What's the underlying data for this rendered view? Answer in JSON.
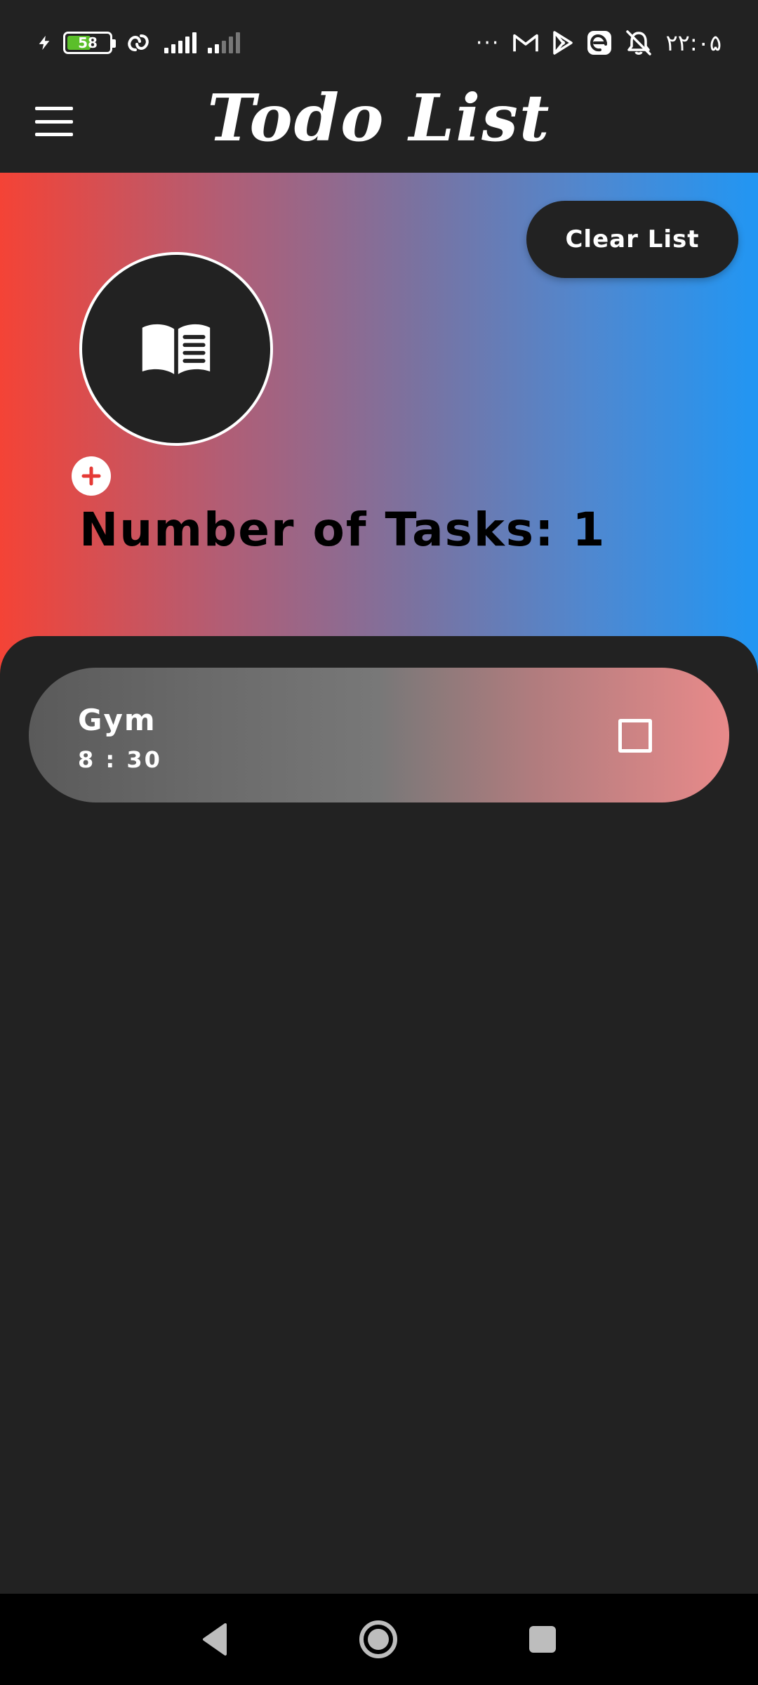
{
  "status_bar": {
    "battery": "58",
    "battery_level": 0.58,
    "time": "۲۲:۰۵",
    "more": "···",
    "icons": [
      "charging-icon",
      "battery-icon",
      "link-icon",
      "signal-icon",
      "signal-icon",
      "gmail-icon",
      "play-store-icon",
      "edge-icon",
      "alarm-off-icon"
    ]
  },
  "app_bar": {
    "title": "Todo List"
  },
  "hero": {
    "clear_label": "Clear List",
    "task_count_label": "Number of Tasks: 1"
  },
  "tasks": [
    {
      "title": "Gym",
      "time": "8 : 30",
      "done": false
    }
  ],
  "colors": {
    "gradient_start": "#f44336",
    "gradient_end": "#2196f3",
    "background": "#222222",
    "card_end": "#e88a8a"
  },
  "nav": {
    "icons": [
      "back-icon",
      "home-icon",
      "recents-icon"
    ]
  }
}
